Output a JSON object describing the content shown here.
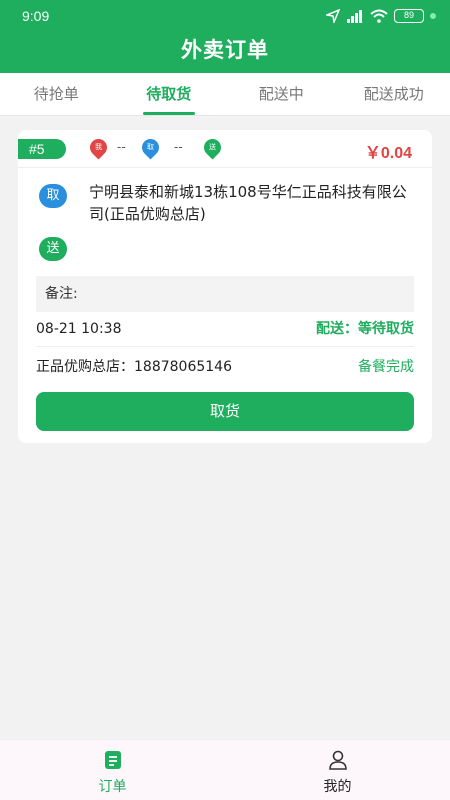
{
  "status_bar": {
    "time": "9:09",
    "battery": "89"
  },
  "header": {
    "title": "外卖订单"
  },
  "tabs": [
    {
      "label": "待抢单",
      "active": false
    },
    {
      "label": "待取货",
      "active": true
    },
    {
      "label": "配送中",
      "active": false
    },
    {
      "label": "配送成功",
      "active": false
    }
  ],
  "order": {
    "number": "#5",
    "pin_me": "我",
    "pin_pickup": "取",
    "pin_deliver": "送",
    "distance_1": "--",
    "distance_2": "--",
    "price": "￥0.04",
    "pickup_badge": "取",
    "deliver_badge": "送",
    "address": "宁明县泰和新城13栋108号华仁正品科技有限公司(正品优购总店)",
    "remark_label": "备注:",
    "time": "08-21 10:38",
    "delivery_status": "配送：等待取货",
    "store_phone": "正品优购总店：18878065146",
    "meal_status": "备餐完成",
    "pickup_button": "取货"
  },
  "bottom_nav": [
    {
      "label": "订单",
      "icon": "order-icon",
      "active": true
    },
    {
      "label": "我的",
      "icon": "profile-icon",
      "active": false
    }
  ],
  "colors": {
    "accent": "#1fad5e",
    "price": "#e24242",
    "pin_me": "#e04646",
    "pin_pickup": "#2a8fdc",
    "pin_deliver": "#1fad5e"
  }
}
